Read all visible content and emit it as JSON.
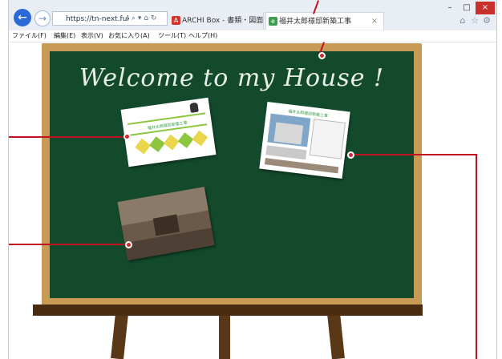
{
  "browser": {
    "address": "https://tn-next.fukuico...",
    "address_controls": "⌕ ▾ ⌂ ↻",
    "tabs": [
      {
        "label": "ARCHI Box - 書類・図面の情報",
        "icon": "archi-box-icon"
      },
      {
        "label": "福井太郎様邸新築工事",
        "icon": "site-icon",
        "close": "×"
      }
    ],
    "window_controls": {
      "minimize": "–",
      "maximize": "□",
      "close": "×"
    },
    "toolbar_icons": [
      "home-icon",
      "star-icon",
      "gear-icon"
    ]
  },
  "menu": [
    "ファイル(F)",
    "編集(E)",
    "表示(V)",
    "お気に入り(A)",
    "ツール(T)",
    "ヘルプ(H)"
  ],
  "board": {
    "title": "Welcome to my House !"
  },
  "cards": [
    {
      "title": "福井太郎様邸新築工事",
      "kind": "document"
    },
    {
      "title": "福井太郎様邸新築工事",
      "kind": "photo-sheet"
    },
    {
      "kind": "panorama"
    }
  ],
  "colors": {
    "chalkboard": "#134a2c",
    "frame": "#c79a56",
    "easel": "#4a2c12",
    "callout": "#c0131f"
  }
}
